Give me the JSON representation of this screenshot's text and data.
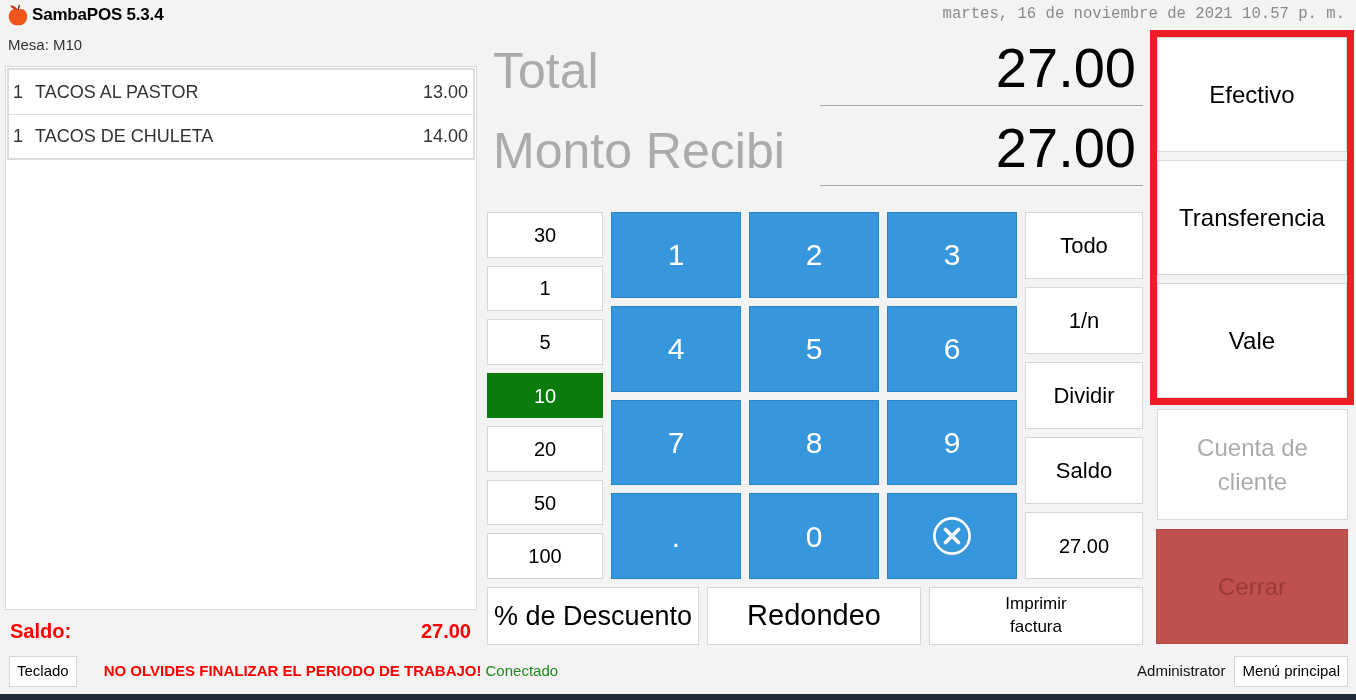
{
  "app": {
    "title": "SambaPOS 5.3.4",
    "datetime": "martes, 16 de noviembre de 2021 10.57 p. m."
  },
  "ticket": {
    "table_label": "Mesa: M10",
    "items": [
      {
        "quantity": "1",
        "name": "TACOS AL PASTOR",
        "price": "13.00"
      },
      {
        "quantity": "1",
        "name": "TACOS DE CHULETA",
        "price": "14.00"
      }
    ],
    "balance_label": "Saldo:",
    "balance": "27.00"
  },
  "totals": [
    {
      "label": "Total",
      "value": "27.00"
    },
    {
      "label": "Monto Recibi",
      "value": "27.00"
    }
  ],
  "quick_amounts": [
    {
      "label": "30",
      "selected": false
    },
    {
      "label": "1",
      "selected": false
    },
    {
      "label": "5",
      "selected": false
    },
    {
      "label": "10",
      "selected": true
    },
    {
      "label": "20",
      "selected": false
    },
    {
      "label": "50",
      "selected": false
    },
    {
      "label": "100",
      "selected": false
    }
  ],
  "keypad": [
    {
      "kind": "key",
      "label": "1"
    },
    {
      "kind": "key",
      "label": "2"
    },
    {
      "kind": "key",
      "label": "3"
    },
    {
      "kind": "key",
      "label": "4"
    },
    {
      "kind": "key",
      "label": "5"
    },
    {
      "kind": "key",
      "label": "6"
    },
    {
      "kind": "key",
      "label": "7"
    },
    {
      "kind": "key",
      "label": "8"
    },
    {
      "kind": "key",
      "label": "9"
    },
    {
      "kind": "key",
      "label": "."
    },
    {
      "kind": "key",
      "label": "0"
    },
    {
      "kind": "clear"
    }
  ],
  "split_options": [
    "Todo",
    "1/n",
    "Dividir",
    "Saldo",
    "27.00"
  ],
  "actions": [
    "% de Descuento",
    "Redondeo",
    "Imprimir factura"
  ],
  "payment_methods": [
    {
      "label": "Efectivo",
      "highlighted": true,
      "disabled": false
    },
    {
      "label": "Transferencia",
      "highlighted": true,
      "disabled": false
    },
    {
      "label": "Vale",
      "highlighted": true,
      "disabled": false
    },
    {
      "label": "Cuenta de cliente",
      "highlighted": false,
      "disabled": true
    }
  ],
  "close_button": {
    "label": "Cerrar",
    "disabled": true
  },
  "status_bar": {
    "keyboard_button": "Teclado",
    "warning": "NO OLVIDES FINALIZAR EL PERIODO DE TRABAJO!",
    "connection": "Conectado",
    "user": "Administrator",
    "main_menu_button": "Menú principal"
  }
}
